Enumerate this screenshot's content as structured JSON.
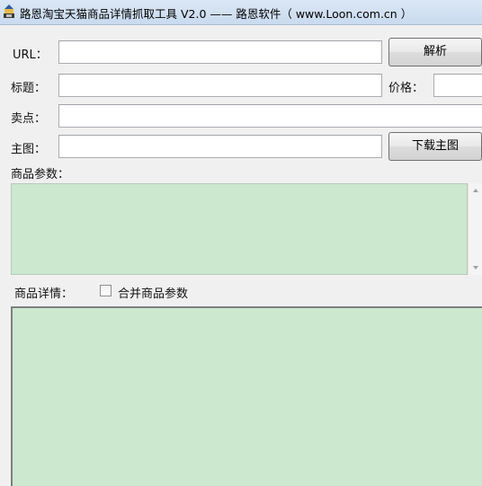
{
  "window": {
    "title": "路恩淘宝天猫商品详情抓取工具 V2.0 —— 路恩软件（ www.Loon.com.cn ）",
    "icon": "app-icon"
  },
  "form": {
    "url_label": "URL：",
    "url_value": "",
    "parse_button": "解析",
    "title_label": "标题：",
    "title_value": "",
    "price_label": "价格：",
    "price_value": "",
    "selling_point_label": "卖点：",
    "selling_point_value": "",
    "main_image_label": "主图：",
    "main_image_value": "",
    "download_button": "下载主图",
    "params_label": "商品参数：",
    "details_label": "商品详情：",
    "merge_checkbox_label": "合并商品参数",
    "merge_checked": false
  },
  "colors": {
    "text_area_bg": "#cce8cf",
    "window_bg": "#f0f0f0"
  }
}
